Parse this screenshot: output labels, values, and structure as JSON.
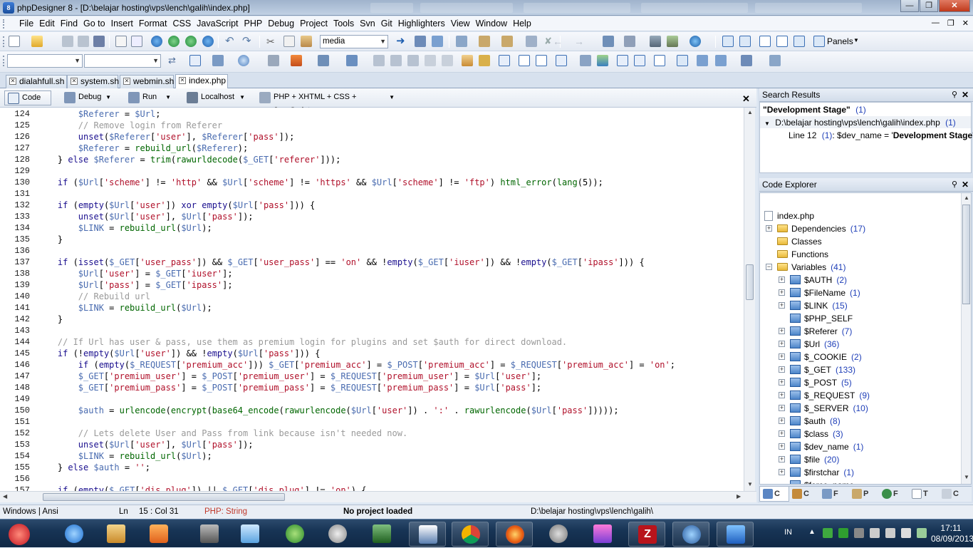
{
  "window": {
    "title": "phpDesigner 8 - [D:\\belajar hosting\\vps\\lench\\galih\\index.php]",
    "controls": [
      "minimize",
      "restore",
      "close"
    ]
  },
  "menubar": {
    "items": [
      "File",
      "Edit",
      "Find",
      "Go to",
      "Insert",
      "Format",
      "CSS",
      "JavaScript",
      "PHP",
      "Debug",
      "Project",
      "Tools",
      "Svn",
      "Git",
      "Highlighters",
      "View",
      "Window",
      "Help"
    ],
    "mdi_controls": [
      "minimize",
      "restore",
      "close"
    ]
  },
  "toolbar1": {
    "search_combo_value": "media",
    "panels_label": "Panels"
  },
  "toolbar2": {
    "combo1_value": "",
    "combo2_value": ""
  },
  "file_tabs": [
    {
      "label": "dialahfull.sh",
      "active": false
    },
    {
      "label": "system.sh",
      "active": false
    },
    {
      "label": "webmin.sh",
      "active": false
    },
    {
      "label": "index.php",
      "active": true
    }
  ],
  "editor_toolbar": {
    "code": "Code",
    "debug": "Debug",
    "run": "Run",
    "localhost": "Localhost",
    "highlighter": "PHP + XHTML + CSS + JavaScript"
  },
  "code_lines": [
    {
      "n": "124",
      "text": "        $Referer = $Url;"
    },
    {
      "n": "125",
      "text": "        // Remove login from Referer"
    },
    {
      "n": "126",
      "text": "        unset($Referer['user'], $Referer['pass']);"
    },
    {
      "n": "127",
      "text": "        $Referer = rebuild_url($Referer);"
    },
    {
      "n": "128",
      "text": "    } else $Referer = trim(rawurldecode($_GET['referer']));"
    },
    {
      "n": "129",
      "text": ""
    },
    {
      "n": "130",
      "text": "    if ($Url['scheme'] != 'http' && $Url['scheme'] != 'https' && $Url['scheme'] != 'ftp') html_error(lang(5));"
    },
    {
      "n": "131",
      "text": ""
    },
    {
      "n": "132",
      "text": "    if (empty($Url['user']) xor empty($Url['pass'])) {"
    },
    {
      "n": "133",
      "text": "        unset($Url['user'], $Url['pass']);"
    },
    {
      "n": "134",
      "text": "        $LINK = rebuild_url($Url);"
    },
    {
      "n": "135",
      "text": "    }"
    },
    {
      "n": "136",
      "text": ""
    },
    {
      "n": "137",
      "text": "    if (isset($_GET['user_pass']) && $_GET['user_pass'] == 'on' && !empty($_GET['iuser']) && !empty($_GET['ipass'])) {"
    },
    {
      "n": "138",
      "text": "        $Url['user'] = $_GET['iuser'];"
    },
    {
      "n": "139",
      "text": "        $Url['pass'] = $_GET['ipass'];"
    },
    {
      "n": "140",
      "text": "        // Rebuild url"
    },
    {
      "n": "141",
      "text": "        $LINK = rebuild_url($Url);"
    },
    {
      "n": "142",
      "text": "    }"
    },
    {
      "n": "143",
      "text": ""
    },
    {
      "n": "144",
      "text": "    // If Url has user & pass, use them as premium login for plugins and set $auth for direct download."
    },
    {
      "n": "145",
      "text": "    if (!empty($Url['user']) && !empty($Url['pass'])) {"
    },
    {
      "n": "146",
      "text": "        if (empty($_REQUEST['premium_acc'])) $_GET['premium_acc'] = $_POST['premium_acc'] = $_REQUEST['premium_acc'] = 'on';"
    },
    {
      "n": "147",
      "text": "        $_GET['premium_user'] = $_POST['premium_user'] = $_REQUEST['premium_user'] = $Url['user'];"
    },
    {
      "n": "148",
      "text": "        $_GET['premium_pass'] = $_POST['premium_pass'] = $_REQUEST['premium_pass'] = $Url['pass'];"
    },
    {
      "n": "149",
      "text": ""
    },
    {
      "n": "150",
      "text": "        $auth = urlencode(encrypt(base64_encode(rawurlencode($Url['user']) . ':' . rawurlencode($Url['pass']))));"
    },
    {
      "n": "151",
      "text": ""
    },
    {
      "n": "152",
      "text": "        // Lets delete User and Pass from link because isn't needed now."
    },
    {
      "n": "153",
      "text": "        unset($Url['user'], $Url['pass']);"
    },
    {
      "n": "154",
      "text": "        $LINK = rebuild_url($Url);"
    },
    {
      "n": "155",
      "text": "    } else $auth = '';"
    },
    {
      "n": "156",
      "text": ""
    },
    {
      "n": "157",
      "text": "    if (empty($_GET['dis_plug']) || $_GET['dis_plug'] != 'on') {"
    }
  ],
  "search_results": {
    "title": "Search Results",
    "query": "\"Development Stage\"",
    "query_count": "(1)",
    "file": "D:\\belajar hosting\\vps\\lench\\galih\\index.php",
    "file_count": "(1)",
    "line_prefix": "Line 12",
    "line_count": "(1)",
    "line_code": ": $dev_name = '",
    "line_match": "Development Stage",
    "line_end": "';"
  },
  "code_explorer": {
    "title": "Code Explorer",
    "file": "index.php",
    "nodes": [
      {
        "label": "Dependencies",
        "count": "(17)"
      },
      {
        "label": "Classes",
        "count": ""
      },
      {
        "label": "Functions",
        "count": ""
      },
      {
        "label": "Variables",
        "count": "(41)"
      }
    ],
    "variables": [
      {
        "label": "$AUTH",
        "count": "(2)"
      },
      {
        "label": "$FileName",
        "count": "(1)"
      },
      {
        "label": "$LINK",
        "count": "(15)"
      },
      {
        "label": "$PHP_SELF",
        "count": ""
      },
      {
        "label": "$Referer",
        "count": "(7)"
      },
      {
        "label": "$Url",
        "count": "(36)"
      },
      {
        "label": "$_COOKIE",
        "count": "(2)"
      },
      {
        "label": "$_GET",
        "count": "(133)"
      },
      {
        "label": "$_POST",
        "count": "(5)"
      },
      {
        "label": "$_REQUEST",
        "count": "(9)"
      },
      {
        "label": "$_SERVER",
        "count": "(10)"
      },
      {
        "label": "$auth",
        "count": "(8)"
      },
      {
        "label": "$class",
        "count": "(3)"
      },
      {
        "label": "$dev_name",
        "count": "(1)"
      },
      {
        "label": "$file",
        "count": "(20)"
      },
      {
        "label": "$firstchar",
        "count": "(1)"
      },
      {
        "label": "$force_name",
        "count": ""
      }
    ],
    "tabs": [
      "C",
      "C",
      "F",
      "P",
      "F",
      "T",
      "C"
    ]
  },
  "statusbar": {
    "encoding": "Windows | Ansi",
    "ln_label": "Ln",
    "position": "15 : Col  31",
    "context": "PHP: String",
    "project": "No project loaded",
    "path": "D:\\belajar hosting\\vps\\lench\\galih\\"
  },
  "taskbar": {
    "language": "IN",
    "time": "17:11",
    "date": "08/09/2013",
    "pinned": [
      "start-button",
      "ie",
      "library",
      "media-player",
      "laptop-app",
      "notepad-app",
      "connection-app",
      "bird-app",
      "terminal-app",
      "network-app",
      "chrome",
      "firefox",
      "ghost-app",
      "paint-app",
      "filezilla",
      "vpn-app",
      "phpdesigner"
    ]
  },
  "colors": {
    "variable": "#4a6cb0",
    "keyword": "#1a0f8e",
    "string": "#b0102a",
    "comment": "#9a9a9a",
    "count": "#1f3fb8",
    "taskbar": "#173455"
  }
}
